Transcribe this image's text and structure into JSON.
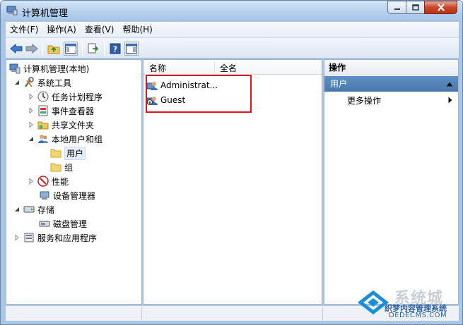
{
  "window": {
    "title": "计算机管理"
  },
  "menu": [
    "文件(F)",
    "操作(A)",
    "查看(V)",
    "帮助(H)"
  ],
  "tree": [
    {
      "label": "计算机管理(本地)",
      "icon": "computer-management-icon"
    },
    {
      "label": "系统工具",
      "icon": "system-tools-icon"
    },
    {
      "label": "任务计划程序",
      "icon": "clock-icon"
    },
    {
      "label": "事件查看器",
      "icon": "event-viewer-icon"
    },
    {
      "label": "共享文件夹",
      "icon": "shared-folder-icon"
    },
    {
      "label": "本地用户和组",
      "icon": "users-group-icon"
    },
    {
      "label": "用户",
      "icon": "folder-icon"
    },
    {
      "label": "组",
      "icon": "folder-icon"
    },
    {
      "label": "性能",
      "icon": "performance-icon"
    },
    {
      "label": "设备管理器",
      "icon": "device-manager-icon"
    },
    {
      "label": "存储",
      "icon": "storage-icon"
    },
    {
      "label": "磁盘管理",
      "icon": "disk-icon"
    },
    {
      "label": "服务和应用程序",
      "icon": "services-icon"
    }
  ],
  "list": {
    "columns": [
      "名称",
      "全名"
    ],
    "rows": [
      {
        "name": "Administrat...",
        "icon": "user-icon"
      },
      {
        "name": "Guest",
        "icon": "user-disabled-icon"
      }
    ]
  },
  "actions": {
    "title": "操作",
    "section": "用户",
    "more": "更多操作"
  },
  "watermark": {
    "text1": "系统城",
    "text2": "织梦内容管理系统",
    "text3": "DEDECMS.COM"
  },
  "colors": {
    "highlight_box": "#e3141e",
    "section_header": "#4a78ae"
  }
}
